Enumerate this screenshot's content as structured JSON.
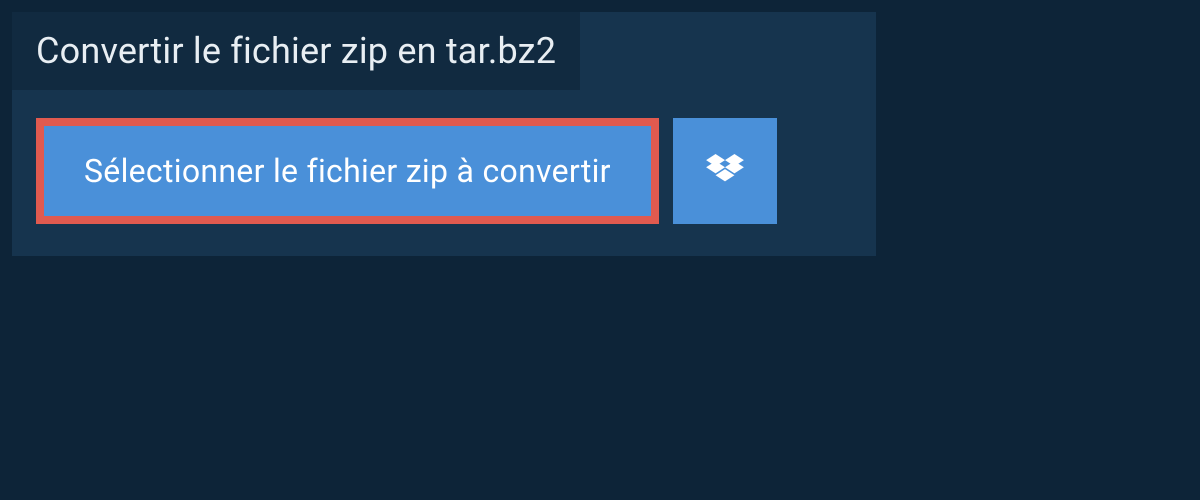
{
  "header": {
    "title": "Convertir le fichier zip en tar.bz2"
  },
  "buttons": {
    "select_file_label": "Sélectionner le fichier zip à convertir"
  },
  "colors": {
    "page_bg": "#0d2438",
    "panel_bg": "#16344e",
    "title_bar_bg": "#112a40",
    "button_bg": "#4a90d9",
    "highlight_border": "#e05a4f",
    "text_light": "#ffffff"
  }
}
